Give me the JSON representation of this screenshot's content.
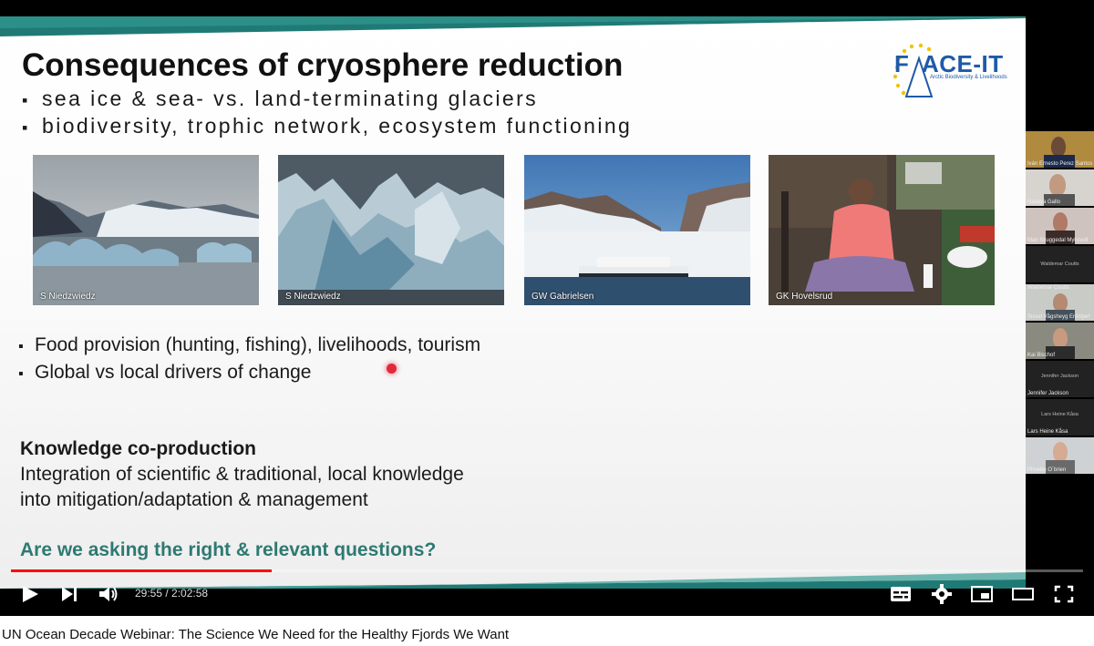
{
  "slide": {
    "title": "Consequences of cryosphere reduction",
    "topics": [
      "sea ice & sea- vs. land-terminating glaciers",
      "biodiversity, trophic network, ecosystem functioning"
    ],
    "bullet_glyph": "▪",
    "logo": {
      "text": "ACE-IT",
      "f_letter": "F",
      "subtitle": "Arctic Biodiversity & Livelihoods"
    },
    "photos": [
      {
        "credit": "S Niedzwiedz"
      },
      {
        "credit": "S Niedzwiedz"
      },
      {
        "credit": "GW Gabrielsen"
      },
      {
        "credit": "GK Hovelsrud"
      }
    ],
    "bullets": [
      "Food provision (hunting, fishing), livelihoods, tourism",
      "Global vs local drivers of change"
    ],
    "knowledge_heading": "Knowledge co-production",
    "knowledge_lines": [
      "Integration of scientific & traditional, local knowledge",
      "into mitigation/adaptation & management"
    ],
    "question": "Are we asking the right & relevant questions?"
  },
  "participants": [
    {
      "name": "Iván Ernesto Perez Santos",
      "video": true
    },
    {
      "name": "Natalya Gallo",
      "video": true
    },
    {
      "name": "Mari Skuggedal Myksvoll",
      "video": true
    },
    {
      "name": "Waldemar Coutts",
      "video": false
    },
    {
      "name": "Waldemar Coutts",
      "video": true
    },
    {
      "name": "Sissel Vågsheyg Erentjert",
      "video": true
    },
    {
      "name": "Kai Bischof",
      "video": false
    },
    {
      "name": "Jennifer Jackson",
      "video": false
    },
    {
      "name": "Lars Heine Kåsa",
      "video": false
    },
    {
      "name": "Lars Heine Kåsa",
      "video": true
    },
    {
      "name": "Phoebe O´brien",
      "video": true
    }
  ],
  "player": {
    "current_time": "29:55",
    "duration": "2:02:58",
    "time_separator": " / ",
    "progress_fraction": 0.243,
    "accent": "#ff0000",
    "controls": [
      "play-icon",
      "next-icon",
      "volume-icon",
      "subtitles-icon",
      "settings-icon",
      "miniplayer-icon",
      "theater-icon",
      "fullscreen-icon"
    ]
  },
  "video_title": "UN Ocean Decade Webinar: The Science We Need for the Healthy Fjords We Want",
  "colors": {
    "teal": "#2e7a72",
    "logo_blue": "#1f5aa8",
    "progress": "#ff0000"
  }
}
